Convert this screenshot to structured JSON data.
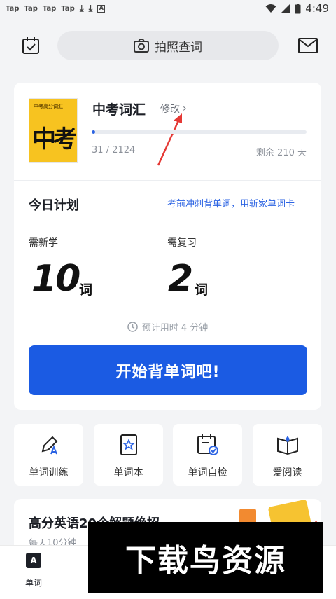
{
  "status_bar": {
    "notifications": [
      "Tap",
      "Tap",
      "Tap",
      "Tap"
    ],
    "time": "4:49"
  },
  "header": {
    "search_placeholder": "拍照查词"
  },
  "book": {
    "name": "中考词汇",
    "edit_label": "修改",
    "cover_title": "中考高分词汇",
    "cover_big": "中考",
    "progress_text": "31 / 2124",
    "progress_fraction": 0.0146,
    "days_left": "剩余 210 天"
  },
  "plan": {
    "title": "今日计划",
    "promo_link": "考前冲刺背单词，用斩家单词卡",
    "new_label": "需新学",
    "new_count": "10",
    "review_label": "需复习",
    "review_count": "2",
    "unit": "词",
    "estimate": "预计用时 4 分钟",
    "start_button": "开始背单词吧!"
  },
  "features": [
    {
      "label": "单词训练",
      "icon": "pencil-icon"
    },
    {
      "label": "单词本",
      "icon": "wordbook-icon"
    },
    {
      "label": "单词自检",
      "icon": "calendar-check-icon"
    },
    {
      "label": "爱阅读",
      "icon": "open-book-icon"
    }
  ],
  "promo": {
    "title": "高分英语20个解题绝招",
    "subtitle": "每天10分钟"
  },
  "bottom_nav": {
    "item_label": "单词",
    "item_icon_letter": "A"
  },
  "watermark": "下载鸟资源",
  "colors": {
    "accent": "#1b5be3",
    "background": "#f3f4f6",
    "book_cover": "#f7c320",
    "arrow": "#e53935"
  }
}
